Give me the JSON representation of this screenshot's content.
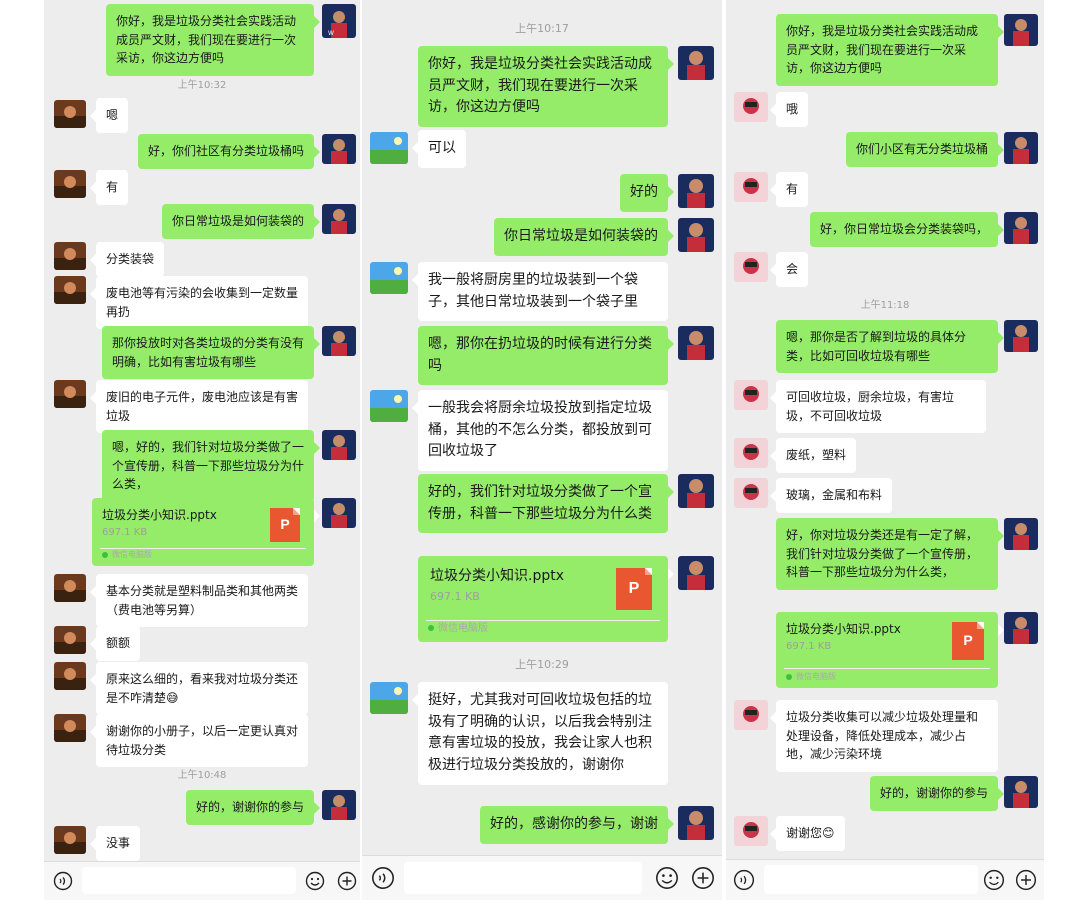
{
  "colors": {
    "outgoing": "#95ec69",
    "incoming": "#ffffff",
    "background": "#ededed"
  },
  "icons": {
    "voice": "voice-icon",
    "emoji": "emoji-icon",
    "more": "add-icon",
    "file": "ppt-file-icon"
  },
  "panels": [
    {
      "messages": [
        {
          "type": "out",
          "text": "你好，我是垃圾分类社会实践活动成员严文财，我们现在要进行一次采访，你这边方便吗"
        },
        {
          "type": "time",
          "text": "上午10:32"
        },
        {
          "type": "in",
          "text": "嗯"
        },
        {
          "type": "out",
          "text": "好，你们社区有分类垃圾桶吗"
        },
        {
          "type": "in",
          "text": "有"
        },
        {
          "type": "out",
          "text": "你日常垃圾是如何装袋的"
        },
        {
          "type": "in",
          "text": "分类装袋"
        },
        {
          "type": "in",
          "text": "废电池等有污染的会收集到一定数量再扔"
        },
        {
          "type": "out",
          "text": "那你投放时对各类垃圾的分类有没有明确，比如有害垃圾有哪些"
        },
        {
          "type": "in",
          "text": "废旧的电子元件，废电池应该是有害垃圾"
        },
        {
          "type": "out",
          "text": "嗯，好的，我们针对垃圾分类做了一个宣传册，科普一下那些垃圾分为什么类，"
        },
        {
          "type": "file",
          "name": "垃圾分类小知识.pptx",
          "size": "697.1 KB",
          "source": "微信电脑版",
          "icon_label": "P"
        },
        {
          "type": "in",
          "text": "基本分类就是塑料制品类和其他两类（费电池等另算）"
        },
        {
          "type": "in",
          "text": "额额"
        },
        {
          "type": "in",
          "text": "原来这么细的，看来我对垃圾分类还是不咋清楚",
          "emoji": "😅"
        },
        {
          "type": "in",
          "text": "谢谢你的小册子，以后一定更认真对待垃圾分类"
        },
        {
          "type": "time",
          "text": "上午10:48"
        },
        {
          "type": "out",
          "text": "好的，谢谢你的参与"
        },
        {
          "type": "in",
          "text": "没事"
        }
      ]
    },
    {
      "messages": [
        {
          "type": "time",
          "text": "上午10:17"
        },
        {
          "type": "out",
          "text": "你好，我是垃圾分类社会实践活动成员严文财，我们现在要进行一次采访，你这边方便吗"
        },
        {
          "type": "in",
          "text": "可以"
        },
        {
          "type": "out",
          "text": "好的"
        },
        {
          "type": "out",
          "text": "你日常垃圾是如何装袋的"
        },
        {
          "type": "in",
          "text": "我一般将厨房里的垃圾装到一个袋子，其他日常垃圾装到一个袋子里"
        },
        {
          "type": "out",
          "text": "嗯，那你在扔垃圾的时候有进行分类吗"
        },
        {
          "type": "in",
          "text": "一般我会将厨余垃圾投放到指定垃圾桶，其他的不怎么分类，都投放到可回收垃圾了"
        },
        {
          "type": "out",
          "text": "好的，我们针对垃圾分类做了一个宣传册，科普一下那些垃圾分为什么类"
        },
        {
          "type": "file",
          "name": "垃圾分类小知识.pptx",
          "size": "697.1 KB",
          "source": "微信电脑版",
          "icon_label": "P"
        },
        {
          "type": "time",
          "text": "上午10:29"
        },
        {
          "type": "in",
          "text": "挺好，尤其我对可回收垃圾包括的垃圾有了明确的认识，以后我会特别注意有害垃圾的投放，我会让家人也积极进行垃圾分类投放的，谢谢你"
        },
        {
          "type": "out",
          "text": "好的，感谢你的参与，谢谢"
        }
      ]
    },
    {
      "messages": [
        {
          "type": "out",
          "text": "你好，我是垃圾分类社会实践活动成员严文财，我们现在要进行一次采访，你这边方便吗"
        },
        {
          "type": "in",
          "text": "哦"
        },
        {
          "type": "out",
          "text": "你们小区有无分类垃圾桶"
        },
        {
          "type": "in",
          "text": "有"
        },
        {
          "type": "out",
          "text": "好，你日常垃圾会分类装袋吗，"
        },
        {
          "type": "in",
          "text": "会"
        },
        {
          "type": "time",
          "text": "上午11:18"
        },
        {
          "type": "out",
          "text": "嗯，那你是否了解到垃圾的具体分类，比如可回收垃圾有哪些"
        },
        {
          "type": "in",
          "text": "可回收垃圾，厨余垃圾，有害垃圾，不可回收垃圾"
        },
        {
          "type": "in",
          "text": "废纸，塑料"
        },
        {
          "type": "in",
          "text": "玻璃，金属和布料"
        },
        {
          "type": "out",
          "text": "好，你对垃圾分类还是有一定了解，我们针对垃圾分类做了一个宣传册，科普一下那些垃圾分为什么类，"
        },
        {
          "type": "file",
          "name": "垃圾分类小知识.pptx",
          "size": "697.1 KB",
          "source": "微信电脑版",
          "icon_label": "P"
        },
        {
          "type": "in",
          "text": "垃圾分类收集可以减少垃圾处理量和处理设备，降低处理成本，减少占地，减少污染环境"
        },
        {
          "type": "out",
          "text": "好的，谢谢你的参与"
        },
        {
          "type": "in",
          "text": "谢谢您",
          "emoji": "😊"
        }
      ]
    }
  ]
}
